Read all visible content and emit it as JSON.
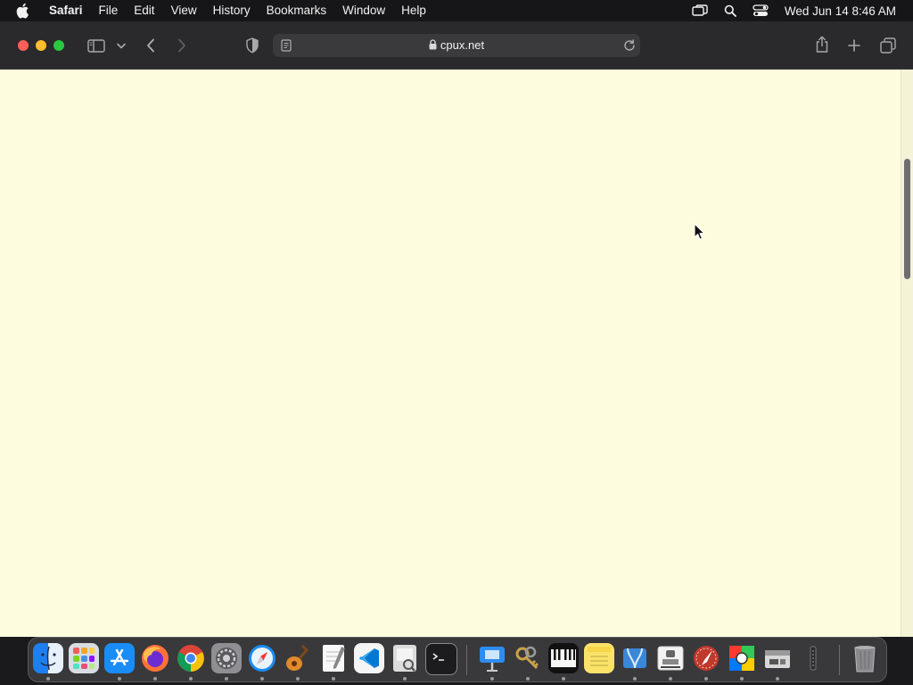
{
  "menubar": {
    "apple_icon": "apple-logo-icon",
    "app_name": "Safari",
    "items": [
      "File",
      "Edit",
      "View",
      "History",
      "Bookmarks",
      "Window",
      "Help"
    ],
    "status_icons": [
      "screen-mirroring-icon",
      "spotlight-search-icon",
      "control-center-icon"
    ],
    "clock": "Wed Jun 14  8:46 AM"
  },
  "toolbar": {
    "icons": [
      "sidebar-icon",
      "chevron-down-icon",
      "back-icon",
      "forward-icon",
      "privacy-shield-icon",
      "share-icon",
      "new-tab-icon",
      "tab-overview-icon"
    ],
    "address": {
      "url": "cpux.net",
      "secure": true,
      "reader_icon": "reader-icon",
      "reload_icon": "reload-icon"
    }
  },
  "content": {
    "background": "#fefcdf"
  },
  "dock": {
    "apps": [
      "Finder",
      "Launchpad",
      "App Store",
      "Firefox",
      "Chrome",
      "System Settings",
      "Safari",
      "GarageBand",
      "TextEdit",
      "VS Code",
      "Preview",
      "Terminal",
      "Keynote",
      "Keychain Access",
      "Piano",
      "Notes",
      "Migration Assistant",
      "Stamp App",
      "Instruments",
      "Color Picker",
      "Boot Camp Assistant",
      "Audio MIDI Setup",
      "Trash"
    ]
  },
  "colors": {
    "close": "#ff5f57",
    "minimize": "#febc2e",
    "maximize": "#28c840",
    "page_background": "#fefcdf"
  }
}
